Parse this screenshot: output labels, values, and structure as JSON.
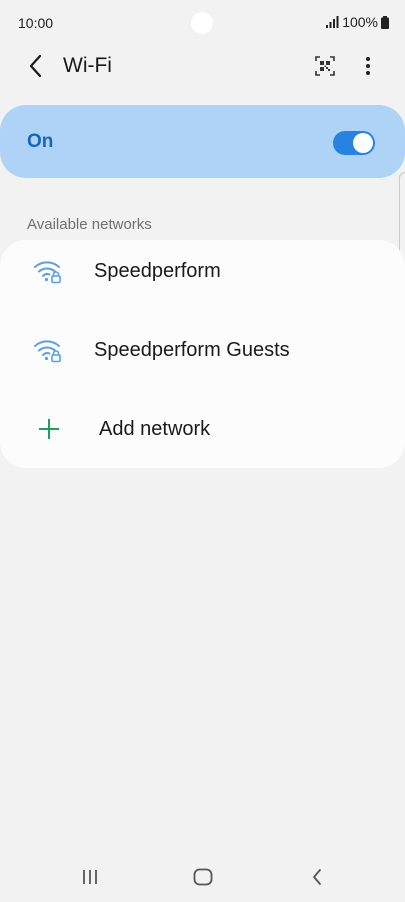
{
  "status_bar": {
    "time": "10:00",
    "battery": "100%"
  },
  "header": {
    "title": "Wi-Fi",
    "icons": [
      "back-arrow-icon",
      "qr-code-icon",
      "more-vertical-icon"
    ]
  },
  "master_toggle": {
    "label": "On",
    "state": true
  },
  "available_networks": {
    "section_title": "Available networks",
    "items": [
      {
        "name": "Speedperform",
        "icon": "wifi-lock-icon"
      },
      {
        "name": "Speedperform Guests",
        "icon": "wifi-lock-icon"
      }
    ],
    "add_network_label": "Add network"
  },
  "nav_bar": {
    "icons": [
      "recent-apps-icon",
      "home-icon",
      "back-icon"
    ]
  },
  "colors": {
    "accent": "#2782e0",
    "toggle_card_bg": "#aed3f7",
    "toggle_label": "#1767b8",
    "wifi_icon": "#5a9fe0",
    "add_icon": "#1ea05a",
    "background": "#f2f2f2"
  }
}
